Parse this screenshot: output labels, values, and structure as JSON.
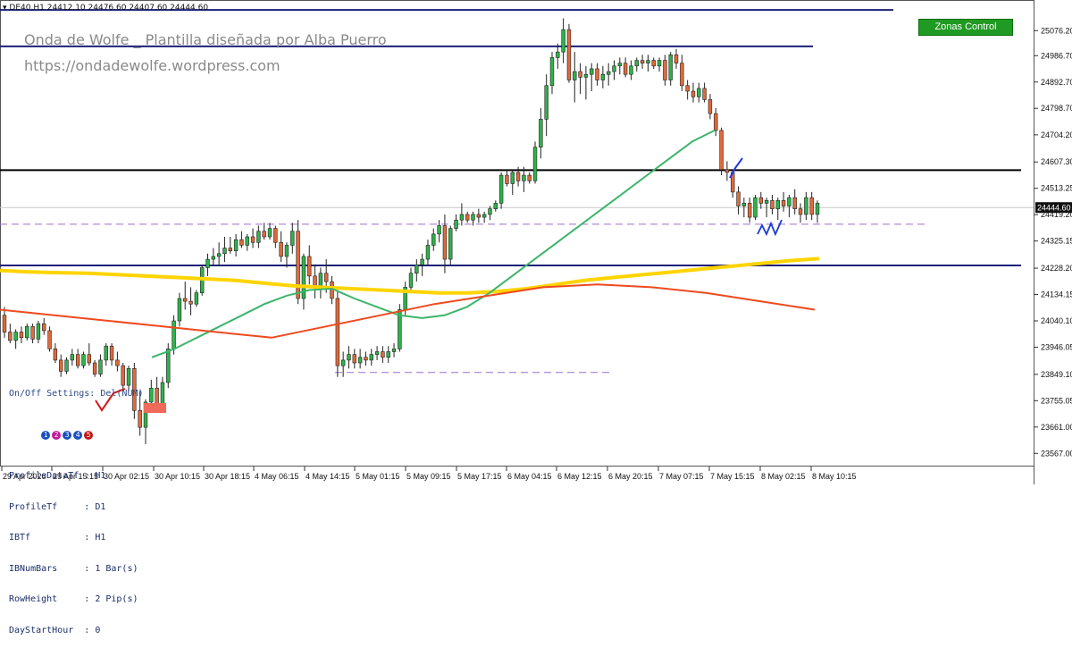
{
  "header": {
    "symbol": "DE40,H1",
    "ohlc": "24412.10 24476.60 24407.60 24444.60"
  },
  "watermark": {
    "title": "Onda de Wolfe _ Plantilla diseñada por Alba Puerro",
    "url": "https://ondadewolfe.wordpress.com"
  },
  "zones_button": {
    "label": "Zonas Control",
    "color": "#1f9a22"
  },
  "profile_panel": {
    "title": "On/Off Settings: Del(NUM)",
    "buttons": [
      "1",
      "2",
      "3",
      "4",
      "5"
    ],
    "button_colors": [
      "#1a4fbf",
      "#c2189a",
      "#1a4fbf",
      "#1a4fbf",
      "#c21818"
    ],
    "lines": [
      "ProfileDataTf : H1",
      "ProfileTf     : D1",
      "IBTf          : H1",
      "IBNumBars     : 1 Bar(s)",
      "RowHeight     : 2 Pip(s)",
      "DayStartHour  : 0"
    ]
  },
  "chart_data": {
    "type": "candlestick",
    "symbol": "DE40",
    "timeframe": "H1",
    "ylim": [
      23520,
      25160
    ],
    "y_ticks": [
      "25076.20",
      "24986.70",
      "24892.70",
      "24798.70",
      "24704.20",
      "24607.30",
      "24513.25",
      "24419.20",
      "24325.15",
      "24228.20",
      "24134.15",
      "24040.10",
      "23946.05",
      "23849.10",
      "23755.05",
      "23661.00",
      "23567.00"
    ],
    "current_price": "24444.60",
    "x_labels": [
      "29 Apr 2026",
      "29 Apr 15:15",
      "30 Apr 02:15",
      "30 Apr 10:15",
      "30 Apr 18:15",
      "4 May 06:15",
      "4 May 14:15",
      "5 May 01:15",
      "5 May 09:15",
      "5 May 17:15",
      "6 May 04:15",
      "6 May 12:15",
      "6 May 20:15",
      "7 May 07:15",
      "7 May 15:15",
      "8 May 02:15",
      "8 May 10:15"
    ],
    "candles": [
      [
        24060,
        24090,
        23980,
        24000
      ],
      [
        24000,
        24030,
        23960,
        23970
      ],
      [
        23970,
        24010,
        23940,
        24000
      ],
      [
        24000,
        24020,
        23960,
        23980
      ],
      [
        23980,
        24030,
        23970,
        24020
      ],
      [
        24020,
        24030,
        23960,
        23975
      ],
      [
        23975,
        24040,
        23960,
        24030
      ],
      [
        24030,
        24050,
        23990,
        24005
      ],
      [
        24005,
        24020,
        23930,
        23940
      ],
      [
        23940,
        23960,
        23890,
        23900
      ],
      [
        23900,
        23920,
        23840,
        23860
      ],
      [
        23860,
        23910,
        23850,
        23900
      ],
      [
        23900,
        23940,
        23880,
        23920
      ],
      [
        23920,
        23940,
        23870,
        23880
      ],
      [
        23880,
        23930,
        23870,
        23920
      ],
      [
        23920,
        23960,
        23880,
        23890
      ],
      [
        23890,
        23900,
        23840,
        23850
      ],
      [
        23850,
        23920,
        23840,
        23900
      ],
      [
        23900,
        23960,
        23880,
        23950
      ],
      [
        23950,
        23960,
        23880,
        23900
      ],
      [
        23900,
        23930,
        23860,
        23880
      ],
      [
        23880,
        23890,
        23790,
        23810
      ],
      [
        23810,
        23880,
        23790,
        23870
      ],
      [
        23870,
        23890,
        23690,
        23720
      ],
      [
        23720,
        23790,
        23630,
        23660
      ],
      [
        23660,
        23760,
        23600,
        23750
      ],
      [
        23750,
        23830,
        23720,
        23800
      ],
      [
        23800,
        23840,
        23720,
        23740
      ],
      [
        23740,
        23840,
        23720,
        23820
      ],
      [
        23820,
        23960,
        23800,
        23940
      ],
      [
        23940,
        24060,
        23920,
        24040
      ],
      [
        24040,
        24140,
        24020,
        24120
      ],
      [
        24120,
        24180,
        24080,
        24110
      ],
      [
        24110,
        24160,
        24060,
        24100
      ],
      [
        24100,
        24150,
        24090,
        24140
      ],
      [
        24140,
        24240,
        24130,
        24230
      ],
      [
        24230,
        24280,
        24200,
        24260
      ],
      [
        24260,
        24300,
        24240,
        24270
      ],
      [
        24270,
        24320,
        24240,
        24280
      ],
      [
        24280,
        24340,
        24250,
        24300
      ],
      [
        24300,
        24340,
        24280,
        24290
      ],
      [
        24290,
        24350,
        24270,
        24330
      ],
      [
        24330,
        24360,
        24300,
        24310
      ],
      [
        24310,
        24350,
        24290,
        24340
      ],
      [
        24340,
        24370,
        24300,
        24320
      ],
      [
        24320,
        24380,
        24300,
        24360
      ],
      [
        24360,
        24390,
        24330,
        24340
      ],
      [
        24340,
        24390,
        24330,
        24370
      ],
      [
        24370,
        24380,
        24300,
        24320
      ],
      [
        24320,
        24360,
        24250,
        24270
      ],
      [
        24270,
        24320,
        24230,
        24310
      ],
      [
        24310,
        24390,
        24280,
        24360
      ],
      [
        24360,
        24400,
        24100,
        24120
      ],
      [
        24120,
        24280,
        24080,
        24270
      ],
      [
        24270,
        24310,
        24170,
        24200
      ],
      [
        24200,
        24240,
        24120,
        24160
      ],
      [
        24160,
        24230,
        24120,
        24210
      ],
      [
        24210,
        24260,
        24140,
        24180
      ],
      [
        24180,
        24200,
        24100,
        24120
      ],
      [
        24120,
        24150,
        23840,
        23880
      ],
      [
        23880,
        23930,
        23840,
        23900
      ],
      [
        23900,
        23950,
        23870,
        23920
      ],
      [
        23920,
        23940,
        23870,
        23890
      ],
      [
        23890,
        23940,
        23870,
        23910
      ],
      [
        23910,
        23930,
        23880,
        23900
      ],
      [
        23900,
        23940,
        23880,
        23920
      ],
      [
        23920,
        23950,
        23900,
        23930
      ],
      [
        23930,
        23950,
        23890,
        23910
      ],
      [
        23910,
        23950,
        23890,
        23930
      ],
      [
        23930,
        23960,
        23910,
        23940
      ],
      [
        23940,
        24100,
        23930,
        24080
      ],
      [
        24080,
        24180,
        24060,
        24160
      ],
      [
        24160,
        24230,
        24140,
        24210
      ],
      [
        24210,
        24260,
        24180,
        24240
      ],
      [
        24240,
        24280,
        24200,
        24260
      ],
      [
        24260,
        24330,
        24240,
        24310
      ],
      [
        24310,
        24370,
        24290,
        24350
      ],
      [
        24350,
        24400,
        24320,
        24380
      ],
      [
        24380,
        24420,
        24210,
        24260
      ],
      [
        24260,
        24380,
        24240,
        24370
      ],
      [
        24370,
        24420,
        24360,
        24400
      ],
      [
        24400,
        24460,
        24380,
        24420
      ],
      [
        24420,
        24430,
        24390,
        24400
      ],
      [
        24400,
        24430,
        24380,
        24420
      ],
      [
        24420,
        24440,
        24390,
        24410
      ],
      [
        24410,
        24430,
        24390,
        24420
      ],
      [
        24420,
        24450,
        24400,
        24440
      ],
      [
        24440,
        24470,
        24430,
        24460
      ],
      [
        24460,
        24570,
        24440,
        24560
      ],
      [
        24560,
        24580,
        24520,
        24530
      ],
      [
        24530,
        24580,
        24490,
        24570
      ],
      [
        24570,
        24590,
        24520,
        24540
      ],
      [
        24540,
        24590,
        24500,
        24560
      ],
      [
        24560,
        24570,
        24530,
        24540
      ],
      [
        24540,
        24680,
        24530,
        24660
      ],
      [
        24660,
        24800,
        24620,
        24760
      ],
      [
        24760,
        24920,
        24700,
        24880
      ],
      [
        24880,
        25000,
        24850,
        24980
      ],
      [
        24980,
        25030,
        24940,
        25000
      ],
      [
        25000,
        25120,
        24960,
        25080
      ],
      [
        25080,
        25100,
        24890,
        24900
      ],
      [
        24900,
        25000,
        24820,
        24930
      ],
      [
        24930,
        24960,
        24850,
        24910
      ],
      [
        24910,
        24950,
        24830,
        24920
      ],
      [
        24920,
        24960,
        24860,
        24940
      ],
      [
        24940,
        24960,
        24880,
        24900
      ],
      [
        24900,
        24950,
        24870,
        24920
      ],
      [
        24920,
        24960,
        24880,
        24930
      ],
      [
        24930,
        24970,
        24900,
        24950
      ],
      [
        24950,
        24980,
        24920,
        24960
      ],
      [
        24960,
        24980,
        24910,
        24920
      ],
      [
        24920,
        24970,
        24900,
        24950
      ],
      [
        24950,
        24980,
        24930,
        24970
      ],
      [
        24970,
        24990,
        24940,
        24960
      ],
      [
        24960,
        24990,
        24930,
        24970
      ],
      [
        24970,
        24980,
        24940,
        24950
      ],
      [
        24950,
        24980,
        24930,
        24970
      ],
      [
        24970,
        24990,
        24880,
        24900
      ],
      [
        24900,
        25000,
        24880,
        24990
      ],
      [
        24990,
        25010,
        24940,
        24960
      ],
      [
        24960,
        24990,
        24860,
        24880
      ],
      [
        24880,
        24900,
        24830,
        24860
      ],
      [
        24860,
        24890,
        24820,
        24840
      ],
      [
        24840,
        24890,
        24820,
        24870
      ],
      [
        24870,
        24890,
        24820,
        24830
      ],
      [
        24830,
        24850,
        24760,
        24780
      ],
      [
        24780,
        24800,
        24700,
        24720
      ],
      [
        24720,
        24730,
        24560,
        24580
      ],
      [
        24580,
        24610,
        24540,
        24570
      ],
      [
        24570,
        24580,
        24480,
        24500
      ],
      [
        24500,
        24520,
        24420,
        24450
      ],
      [
        24450,
        24480,
        24410,
        24460
      ],
      [
        24460,
        24480,
        24390,
        24410
      ],
      [
        24410,
        24490,
        24400,
        24480
      ],
      [
        24480,
        24500,
        24440,
        24460
      ],
      [
        24460,
        24480,
        24410,
        24470
      ],
      [
        24470,
        24490,
        24420,
        24440
      ],
      [
        24440,
        24480,
        24400,
        24470
      ],
      [
        24470,
        24500,
        24430,
        24450
      ],
      [
        24450,
        24490,
        24410,
        24480
      ],
      [
        24480,
        24510,
        24420,
        24440
      ],
      [
        24440,
        24460,
        24390,
        24420
      ],
      [
        24420,
        24500,
        24400,
        24480
      ],
      [
        24480,
        24500,
        24400,
        24420
      ],
      [
        24420,
        24470,
        24390,
        24460
      ]
    ],
    "horizontal_lines": [
      {
        "price": 25150,
        "color": "#1b1f7a",
        "style": "solid",
        "width": 2
      },
      {
        "price": 25020,
        "color": "#1b1f7a",
        "style": "solid",
        "width": 2
      },
      {
        "price": 24578,
        "color": "#000000",
        "style": "solid",
        "width": 2
      },
      {
        "price": 24385,
        "color": "#9a6fd0",
        "style": "dashed",
        "width": 1
      },
      {
        "price": 24238,
        "color": "#1b1f7a",
        "style": "solid",
        "width": 2
      },
      {
        "price": 23856,
        "color": "#9a6fd0",
        "style": "dashed",
        "width": 1
      }
    ],
    "moving_averages": [
      {
        "color": "#ffd400",
        "width": 4,
        "values": [
          24220,
          24215,
          24212,
          24210,
          24205,
          24200,
          24195,
          24190,
          24185,
          24175,
          24165,
          24160,
          24155,
          24150,
          24145,
          24140,
          24140,
          24145,
          24155,
          24170,
          24185,
          24195,
          24205,
          24215,
          24225,
          24235,
          24245,
          24255,
          24262
        ]
      },
      {
        "color": "#3cb56a",
        "width": 2,
        "values": [
          23910,
          23940,
          23980,
          24020,
          24060,
          24100,
          24130,
          24150,
          24155,
          24120,
          24090,
          24060,
          24050,
          24060,
          24090,
          24140,
          24200,
          24260,
          24320,
          24380,
          24440,
          24500,
          24560,
          24620,
          24680,
          24720
        ]
      },
      {
        "color": "#ee4a1f",
        "width": 2,
        "values": [
          24080,
          24060,
          24040,
          24020,
          24000,
          23980,
          24020,
          24060,
          24100,
          24130,
          24160,
          24170,
          24160,
          24140,
          24110,
          24080
        ]
      }
    ]
  }
}
